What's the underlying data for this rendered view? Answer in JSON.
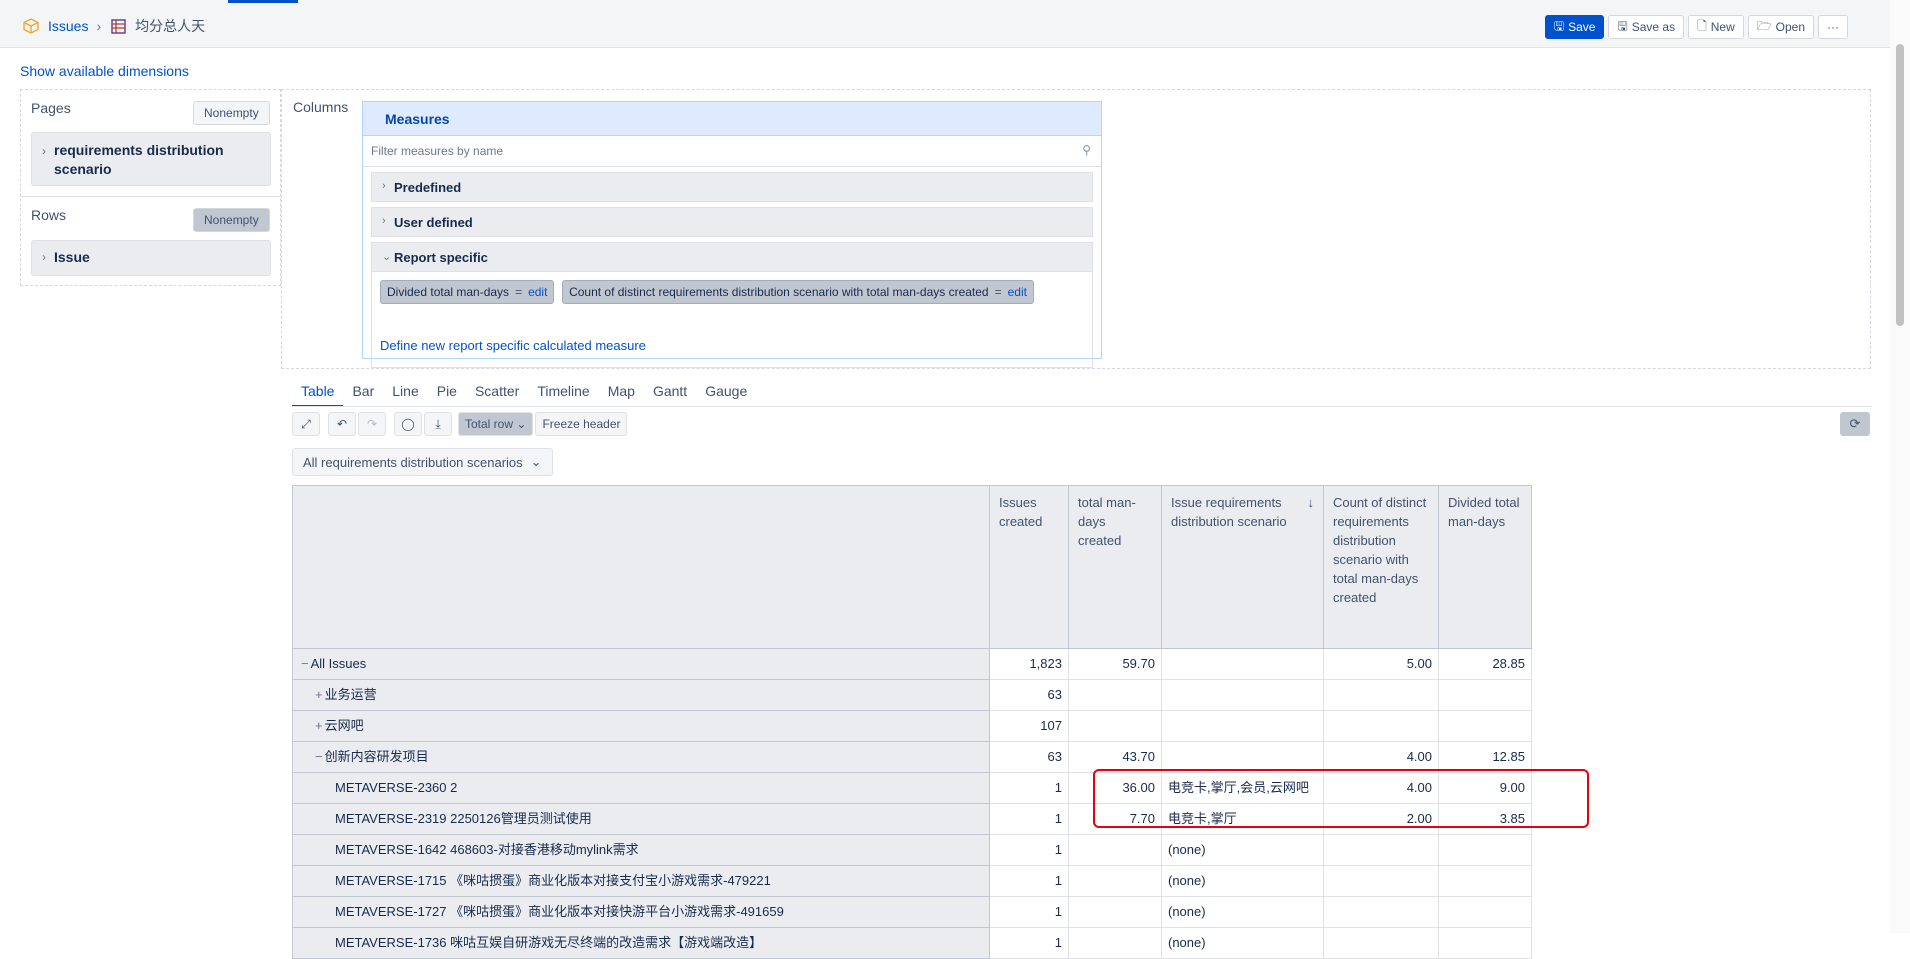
{
  "breadcrumb": {
    "root": "Issues",
    "separator": "›",
    "report": "均分总人天"
  },
  "header_buttons": {
    "save": "Save",
    "save_as": "Save as",
    "new": "New",
    "open": "Open",
    "more": "···"
  },
  "show_dimensions": "Show available dimensions",
  "pages": {
    "title": "Pages",
    "nonempty": "Nonempty",
    "dimension": "requirements distribution scenario"
  },
  "rows": {
    "title": "Rows",
    "nonempty": "Nonempty",
    "dimension": "Issue"
  },
  "columns": {
    "title": "Columns"
  },
  "measures": {
    "title": "Measures",
    "filter_placeholder": "Filter measures by name",
    "groups": [
      "Predefined",
      "User defined",
      "Report specific"
    ],
    "chips": [
      {
        "name": "Divided total man-days",
        "eq": "=",
        "edit": "edit"
      },
      {
        "name": "Count of distinct requirements distribution scenario with total man-days created",
        "eq": "=",
        "edit": "edit"
      }
    ],
    "define_new": "Define new report specific calculated measure"
  },
  "view_tabs": [
    "Table",
    "Bar",
    "Line",
    "Pie",
    "Scatter",
    "Timeline",
    "Map",
    "Gantt",
    "Gauge"
  ],
  "active_tab": "Table",
  "toolbar": {
    "total_row": "Total row",
    "freeze_header": "Freeze header"
  },
  "page_selector": "All requirements distribution scenarios",
  "table": {
    "headers": [
      "Issues created",
      "total man-days created",
      "Issue requirements distribution scenario",
      "Count of distinct requirements distribution scenario with total man-days created",
      "Divided total man-days"
    ],
    "sort_indicator": "↓",
    "rows": [
      {
        "prefix": "−",
        "label": "All Issues",
        "indent": 0,
        "cells": [
          "1,823",
          "59.70",
          "",
          "5.00",
          "28.85"
        ]
      },
      {
        "prefix": "+",
        "label": "业务运营",
        "indent": 1,
        "cells": [
          "63",
          "",
          "",
          "",
          ""
        ]
      },
      {
        "prefix": "+",
        "label": "云网吧",
        "indent": 1,
        "cells": [
          "107",
          "",
          "",
          "",
          ""
        ]
      },
      {
        "prefix": "−",
        "label": "创新内容研发项目",
        "indent": 1,
        "cells": [
          "63",
          "43.70",
          "",
          "4.00",
          "12.85"
        ]
      },
      {
        "prefix": "",
        "label": "METAVERSE-2360 2",
        "indent": 2,
        "cells": [
          "1",
          "36.00",
          "电竞卡,掌厅,会员,云网吧",
          "4.00",
          "9.00"
        ]
      },
      {
        "prefix": "",
        "label": "METAVERSE-2319 2250126管理员测试使用",
        "indent": 2,
        "cells": [
          "1",
          "7.70",
          "电竞卡,掌厅",
          "2.00",
          "3.85"
        ]
      },
      {
        "prefix": "",
        "label": "METAVERSE-1642 468603-对接香港移动mylink需求",
        "indent": 2,
        "cells": [
          "1",
          "",
          "(none)",
          "",
          ""
        ]
      },
      {
        "prefix": "",
        "label": "METAVERSE-1715 《咪咕掼蛋》商业化版本对接支付宝小游戏需求-479221",
        "indent": 2,
        "cells": [
          "1",
          "",
          "(none)",
          "",
          ""
        ]
      },
      {
        "prefix": "",
        "label": "METAVERSE-1727 《咪咕掼蛋》商业化版本对接快游平台小游戏需求-491659",
        "indent": 2,
        "cells": [
          "1",
          "",
          "(none)",
          "",
          ""
        ]
      },
      {
        "prefix": "",
        "label": "METAVERSE-1736 咪咕互娱自研游戏无尽终端的改造需求【游戏端改造】",
        "indent": 2,
        "cells": [
          "1",
          "",
          "(none)",
          "",
          ""
        ]
      }
    ]
  },
  "colors": {
    "accent": "#0052cc",
    "highlight": "#e3000f"
  }
}
